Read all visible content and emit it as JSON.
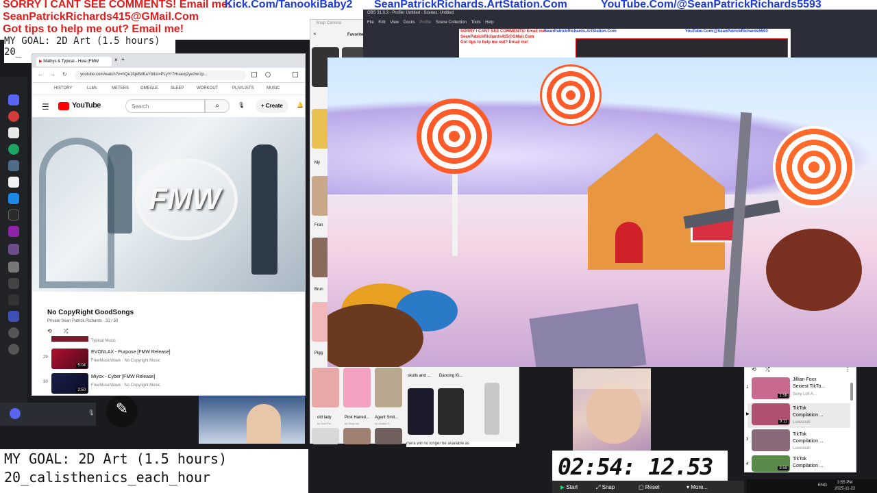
{
  "banner": {
    "line1_red": "SORRY I CANT SEE COMMENTS! Email me:",
    "kick": "Kick.Com/TanookiBaby2",
    "artstation": "SeanPatrickRichards.ArtStation.Com",
    "youtube": "YouTube.Com/@SeanPatrickRichards5593",
    "email": "SeanPatrickRichards415@GMail.Com",
    "tips": "Got tips to help me out? Email me!"
  },
  "overlay_goal_small": "MY GOAL: 2D Art (1.5 hours)",
  "overlay_goal_small2": "20_",
  "browser": {
    "tab_title": "Mathys & Typical - Hola (FMW",
    "url": "youtube.com/watch?v=hQe1fqkBdKaYbttst=PLyYr7Huauq2ye2wrzp...",
    "bookmarks": [
      "HISTORY",
      "LLMs",
      "METERS",
      "OMEGLE",
      "SLEEP",
      "WORKOUT",
      "PLAYLISTS",
      "MUSIC"
    ],
    "youtube_logo": "YouTube",
    "search_placeholder": "Search",
    "create_label": "Create",
    "video_logo_text": "FMW",
    "playlist": {
      "title": "No CopyRight GoodSongs",
      "meta": "Private  Sean Patrick Richards · 31 / 50",
      "items": [
        {
          "index": "",
          "title": "",
          "channel": "Typical Music",
          "duration": ""
        },
        {
          "index": "29",
          "title": "EVONLAX - Purpose [FMW Release]",
          "channel": "FreeMusicWave · No Copyright Music",
          "duration": "5:04"
        },
        {
          "index": "30",
          "title": "Miyox - Cyber [FMW Release]",
          "channel": "FreeMusicWave · No Copyright Music",
          "duration": "2:50"
        }
      ]
    }
  },
  "obs": {
    "title": "OBS 31.0.3 - Profile: Untitled - Scenes: Untitled",
    "menu": [
      "File",
      "Edit",
      "View",
      "Docks",
      "Profile",
      "Scene Collection",
      "Tools",
      "Help"
    ]
  },
  "snapcam": {
    "title": "Snap Camera",
    "favorites": "Favorites",
    "lenses_bottom": [
      {
        "name": "old lady",
        "by": "by Tom Pro"
      },
      {
        "name": "Pink Haired...",
        "by": "by Snap Inc"
      },
      {
        "name": "Agent Smit...",
        "by": "by Jordan G"
      }
    ],
    "lenses_side": [
      "skulls and ...",
      "Dancing Ki..."
    ],
    "side_labels": [
      "Fran",
      "Brun",
      "Pigg",
      "My"
    ],
    "notice": "mera will no longer be available as"
  },
  "music": {
    "items": [
      {
        "index": "1",
        "title": "Jillian Foxx",
        "subtitle": "Sexiest TikTo...",
        "channel": "Sexy Lofi A...",
        "duration": "1:58",
        "color": "#c86a8f"
      },
      {
        "index": "",
        "title": "TikTok",
        "subtitle": "Compilation ...",
        "channel": "Luxestudi",
        "duration": "9:11",
        "color": "#b05070"
      },
      {
        "index": "3",
        "title": "TikTok",
        "subtitle": "Compilation ...",
        "channel": "Luxestudi",
        "duration": "",
        "color": "#8a6a7a"
      },
      {
        "index": "4",
        "title": "TikTok",
        "subtitle": "Compilation ...",
        "channel": "",
        "duration": "9:59",
        "color": "#5a8a4a"
      }
    ]
  },
  "goal": {
    "line1": "MY GOAL: 2D Art (1.5 hours)",
    "line2": "20_calisthenics_each_hour"
  },
  "timer": {
    "value": "02:54: 12.53",
    "start": "Start",
    "snap": "Snap",
    "reset": "Reset",
    "more": "More..."
  },
  "tray": {
    "lang": "ENG",
    "time": "3:55 PM",
    "date": "2025-11-22"
  },
  "colors": {
    "red": "#e41b1b",
    "blue": "#1d3bd6",
    "youtube_red": "#ff0000"
  }
}
